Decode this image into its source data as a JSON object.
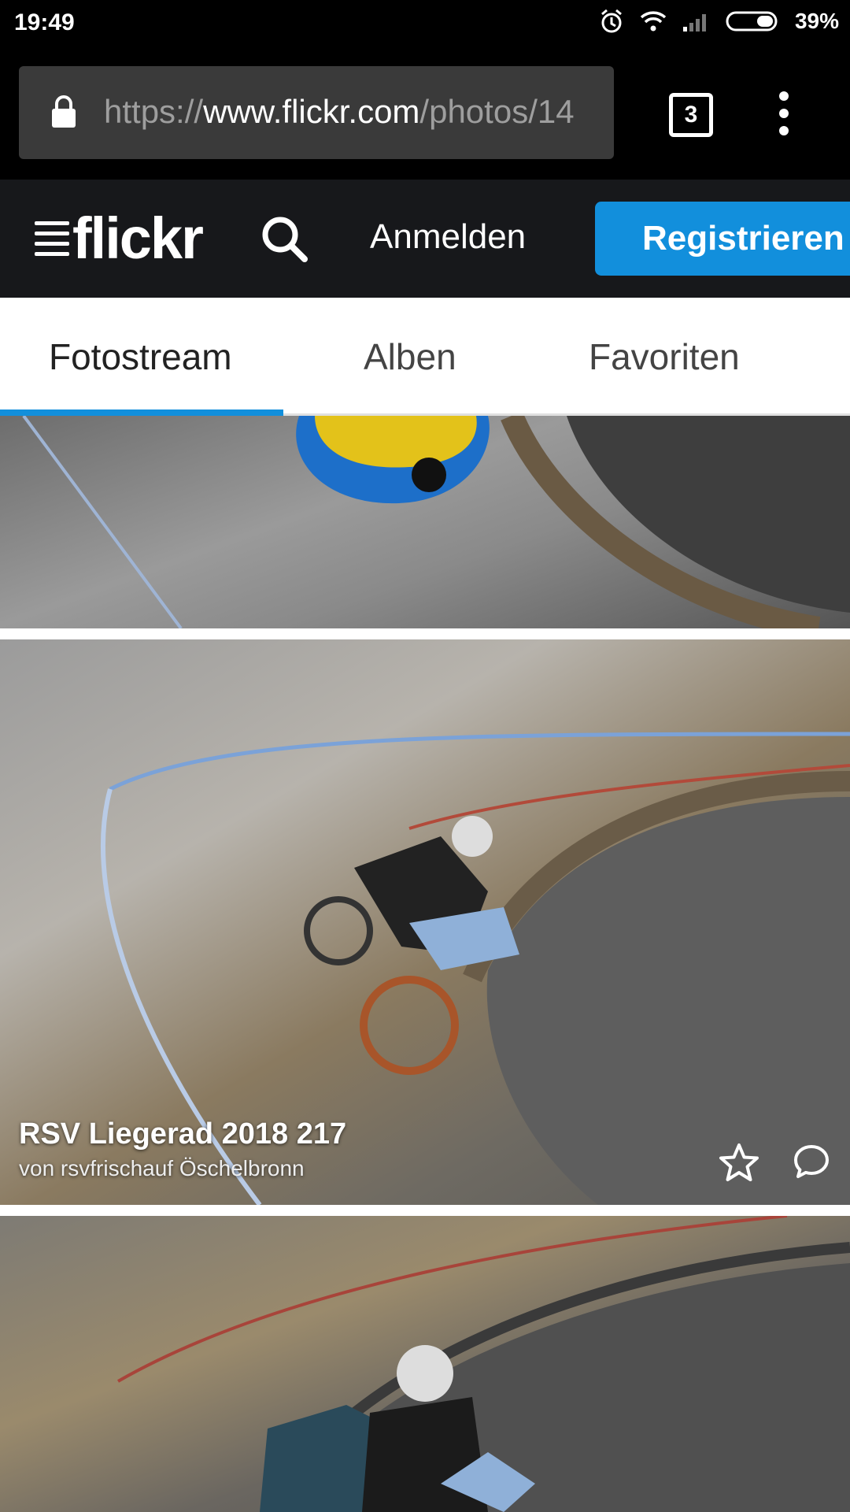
{
  "status_bar": {
    "time": "19:49",
    "battery_pct": "39%",
    "icons": [
      "alarm-icon",
      "wifi-icon",
      "signal-icon",
      "battery-icon"
    ]
  },
  "browser": {
    "url_scheme": "https://",
    "url_host": "www.flickr.com",
    "url_path": "/photos/14",
    "tab_count": "3",
    "icons": [
      "lock-icon",
      "menu-dots-icon"
    ]
  },
  "flickr_header": {
    "logo_text": "flickr",
    "sign_in": "Anmelden",
    "register": "Registrieren",
    "accent_color": "#128fdc"
  },
  "subnav": {
    "tabs": [
      {
        "label": "Fotostream",
        "active": true
      },
      {
        "label": "Alben",
        "active": false
      },
      {
        "label": "Favoriten",
        "active": false
      }
    ]
  },
  "photos": [
    {
      "title": "",
      "author": ""
    },
    {
      "title": "RSV Liegerad 2018 217",
      "author": "von rsvfrischauf Öschelbronn",
      "actions": [
        "star-icon",
        "comment-icon"
      ]
    },
    {
      "title": "",
      "author": ""
    }
  ]
}
